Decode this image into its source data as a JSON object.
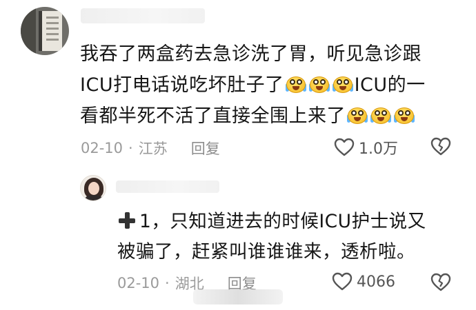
{
  "comment": {
    "text_lines": [
      "我吞了两盒药去急诊洗了胃，听见急诊跟",
      "ICU打电话说吃坏肚子了",
      "ICU的一",
      "看都半死不活了直接全围上来了"
    ],
    "date": "02-10",
    "separator": "·",
    "location": "江苏",
    "reply_label": "回复",
    "likes": "1.0万"
  },
  "reply": {
    "prefix": "1，只知道进去的时候ICU护士说又",
    "line2": "被骗了，赶紧叫谁谁谁来，透析啦。",
    "date": "02-10",
    "separator": "·",
    "location": "湖北",
    "reply_label": "回复",
    "likes": "4066"
  },
  "icons": {
    "like": "heart-outline-icon",
    "dislike": "broken-heart-icon",
    "emoji": "crying-laughing-emoji-icon",
    "plus": "heavy-plus-icon"
  }
}
